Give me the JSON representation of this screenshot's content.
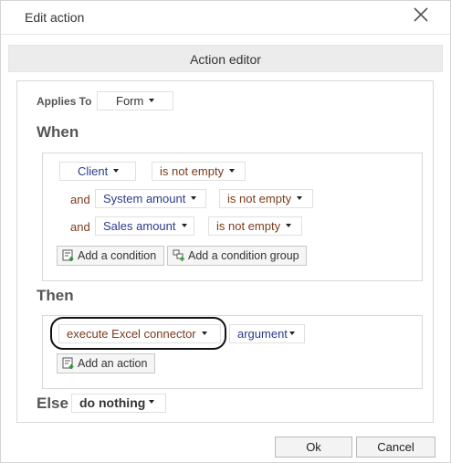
{
  "dialog": {
    "title": "Edit action",
    "editor_header": "Action editor"
  },
  "applies_to": {
    "label": "Applies To",
    "value": "Form"
  },
  "when": {
    "heading": "When",
    "conditions": [
      {
        "connector": "",
        "field": "Client",
        "operator": "is not empty"
      },
      {
        "connector": "and",
        "field": "System amount",
        "operator": "is not empty"
      },
      {
        "connector": "and",
        "field": "Sales amount",
        "operator": "is not empty"
      }
    ],
    "add_condition_label": "Add a condition",
    "add_condition_group_label": "Add a condition group"
  },
  "then": {
    "heading": "Then",
    "action": "execute Excel connector",
    "argument": "argument",
    "add_action_label": "Add an action"
  },
  "else": {
    "heading": "Else",
    "value": "do nothing"
  },
  "footer": {
    "ok_label": "Ok",
    "cancel_label": "Cancel"
  },
  "icons": {
    "close": "close-icon",
    "caret": "caret-down-icon",
    "add_condition": "add-condition-icon",
    "add_group": "add-group-icon",
    "add_action": "add-action-icon"
  },
  "colors": {
    "field_text": "#2d3b8e",
    "operator_text": "#7a3b1c",
    "heading_text": "#555555",
    "highlight_ring": "#111111"
  }
}
